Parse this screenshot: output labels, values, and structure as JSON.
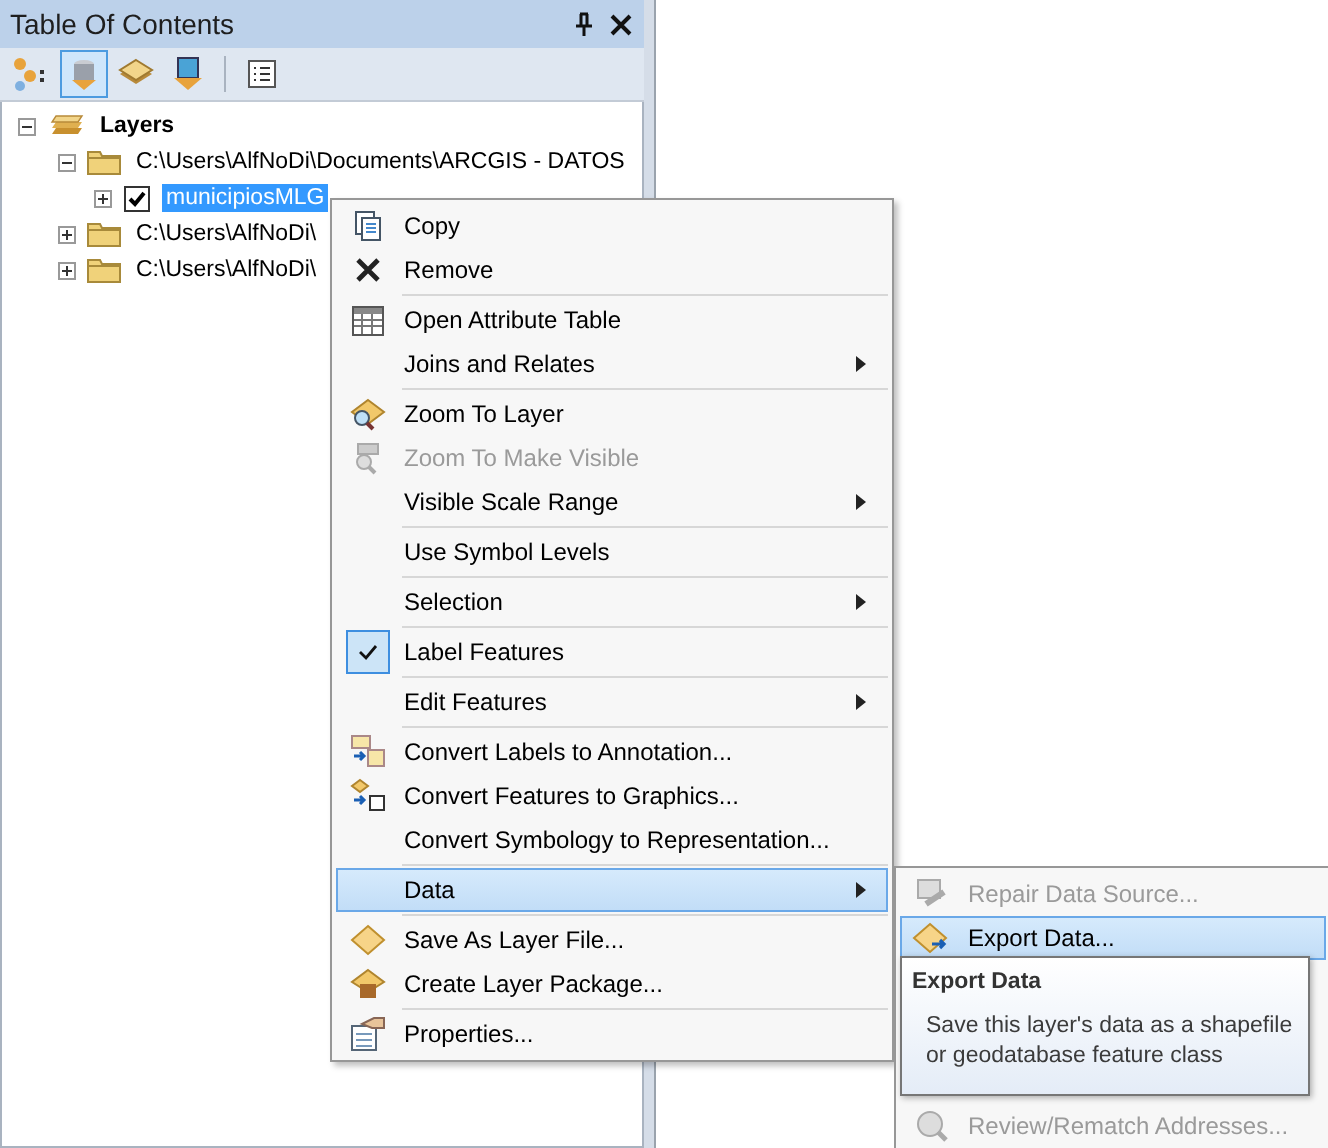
{
  "panel": {
    "title": "Table Of Contents"
  },
  "toolbar": [
    {
      "selected": false
    },
    {
      "selected": true
    },
    {
      "selected": false
    },
    {
      "selected": false
    },
    {
      "selected": false
    }
  ],
  "tree": {
    "label": "Layers",
    "expanded": true,
    "children": [
      {
        "label": "C:\\Users\\AlfNoDi\\Documents\\ARCGIS - DATOS",
        "expanded": true,
        "children": [
          {
            "label": "municipiosMLG",
            "checked": true,
            "selected": true,
            "expanded": false
          }
        ]
      },
      {
        "label": "C:\\Users\\AlfNoDi\\",
        "expanded": false
      },
      {
        "label": "C:\\Users\\AlfNoDi\\",
        "expanded": false
      }
    ]
  },
  "menu": {
    "groups": [
      [
        {
          "label": "Copy",
          "disabled": false,
          "submenu": false,
          "checked": false,
          "selected": false
        },
        {
          "label": "Remove",
          "disabled": false,
          "submenu": false,
          "checked": false,
          "selected": false
        }
      ],
      [
        {
          "label": "Open Attribute Table",
          "disabled": false,
          "submenu": false,
          "checked": false,
          "selected": false
        },
        {
          "label": "Joins and Relates",
          "disabled": false,
          "submenu": true,
          "checked": false,
          "selected": false
        }
      ],
      [
        {
          "label": "Zoom To Layer",
          "disabled": false,
          "submenu": false,
          "checked": false,
          "selected": false
        },
        {
          "label": "Zoom To Make Visible",
          "disabled": true,
          "submenu": false,
          "checked": false,
          "selected": false
        },
        {
          "label": "Visible Scale Range",
          "disabled": false,
          "submenu": true,
          "checked": false,
          "selected": false
        }
      ],
      [
        {
          "label": "Use Symbol Levels",
          "disabled": false,
          "submenu": false,
          "checked": false,
          "selected": false
        }
      ],
      [
        {
          "label": "Selection",
          "disabled": false,
          "submenu": true,
          "checked": false,
          "selected": false
        }
      ],
      [
        {
          "label": "Label Features",
          "disabled": false,
          "submenu": false,
          "checked": true,
          "selected": false
        }
      ],
      [
        {
          "label": "Edit Features",
          "disabled": false,
          "submenu": true,
          "checked": false,
          "selected": false
        }
      ],
      [
        {
          "label": "Convert Labels to Annotation...",
          "disabled": false,
          "submenu": false,
          "checked": false,
          "selected": false
        },
        {
          "label": "Convert Features to Graphics...",
          "disabled": false,
          "submenu": false,
          "checked": false,
          "selected": false
        },
        {
          "label": "Convert Symbology to Representation...",
          "disabled": false,
          "submenu": false,
          "checked": false,
          "selected": false
        }
      ],
      [
        {
          "label": "Data",
          "disabled": false,
          "submenu": true,
          "checked": false,
          "selected": true
        }
      ],
      [
        {
          "label": "Save As Layer File...",
          "disabled": false,
          "submenu": false,
          "checked": false,
          "selected": false
        },
        {
          "label": "Create Layer Package...",
          "disabled": false,
          "submenu": false,
          "checked": false,
          "selected": false
        }
      ],
      [
        {
          "label": "Properties...",
          "disabled": false,
          "submenu": false,
          "checked": false,
          "selected": false
        }
      ]
    ]
  },
  "submenu": {
    "items": [
      {
        "label": "Repair Data Source...",
        "disabled": true,
        "selected": false
      },
      {
        "label": "Export Data...",
        "disabled": false,
        "selected": true
      }
    ],
    "bottom_items": [
      {
        "label": "Review/Rematch Addresses...",
        "disabled": true,
        "selected": false
      }
    ]
  },
  "tooltip": {
    "title": "Export Data",
    "text": "Save this layer's data as a shapefile\nor geodatabase feature class"
  }
}
